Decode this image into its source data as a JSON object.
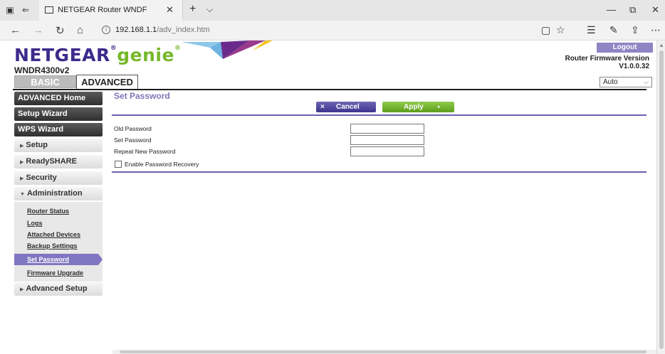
{
  "browser": {
    "tab_title": "NETGEAR Router WNDF",
    "tab_close": "✕",
    "new_tab": "+",
    "tab_menu": "⌵",
    "window_controls": {
      "minimize": "—",
      "restore": "⧉",
      "close": "✕"
    },
    "nav": {
      "back": "←",
      "forward": "→",
      "refresh": "↻",
      "home": "⌂"
    },
    "url_info": "i",
    "url_host": "192.168.1.1",
    "url_path": "/adv_index.htm",
    "icons": {
      "reading_view": "▢",
      "favorite": "☆",
      "favorites_hub": "☰",
      "notes": "✎",
      "share": "⇪",
      "more": "⋯"
    }
  },
  "header": {
    "brand": "NETGEAR",
    "brand_reg": "®",
    "product": "genie",
    "product_reg": "®",
    "model": "WNDR4300v2",
    "logout": "Logout",
    "firmware_label": "Router Firmware Version",
    "firmware_version": "V1.0.0.32",
    "tabs": {
      "basic": "BASIC",
      "advanced": "ADVANCED"
    },
    "language": "Auto"
  },
  "sidebar": {
    "advanced_home": "ADVANCED Home",
    "setup_wizard": "Setup Wizard",
    "wps_wizard": "WPS Wizard",
    "setup": "Setup",
    "readyshare": "ReadySHARE",
    "security": "Security",
    "administration": "Administration",
    "admin_items": {
      "router_status": "Router Status",
      "logs": "Logs",
      "attached_devices": "Attached Devices",
      "backup_settings": "Backup Settings",
      "set_password": "Set Password",
      "firmware_upgrade": "Firmware Upgrade"
    },
    "advanced_setup": "Advanced Setup"
  },
  "content": {
    "title": "Set Password",
    "cancel": "Cancel",
    "cancel_icon": "×",
    "apply": "Apply",
    "apply_icon": "▸",
    "fields": {
      "old_password": "Old Password",
      "set_password": "Set Password",
      "repeat_password": "Repeat New Password"
    },
    "recovery_label": "Enable Password Recovery",
    "recovery_checked": false
  },
  "colors": {
    "brand_purple": "#3d2a8c",
    "genie_green": "#76b82a",
    "accent_lavender": "#7f75b9",
    "apply_green": "#6fae2c"
  }
}
